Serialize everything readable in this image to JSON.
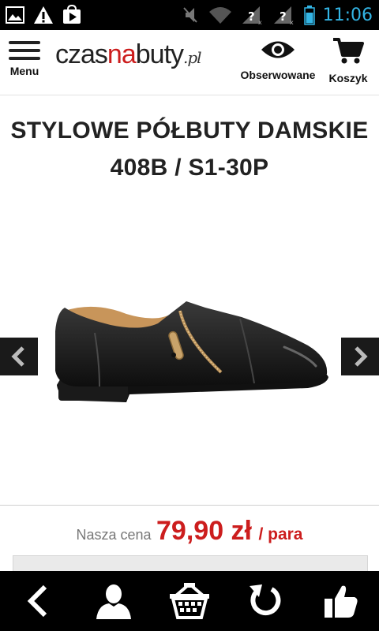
{
  "status_bar": {
    "time": "11:06"
  },
  "header": {
    "menu_label": "Menu",
    "logo": {
      "part1": "czas",
      "part2": "na",
      "part3": "buty",
      "part4": ".pl"
    },
    "observed_label": "Obserwowane",
    "cart_label": "Koszyk"
  },
  "product": {
    "title": "STYLOWE PÓŁBUTY DAMSKIE 408B / S1-30P",
    "price_label": "Nasza cena",
    "price": "79,90 zł",
    "price_unit": "/ para"
  },
  "colors": {
    "accent": "#cc1d1d",
    "status_time": "#33b5e5"
  },
  "icons": {
    "status_left": [
      "image-icon",
      "warning-icon",
      "play-store-icon"
    ],
    "status_right": [
      "muted-icon",
      "wifi-icon",
      "signal-unknown-icon",
      "signal-unknown-icon",
      "battery-icon"
    ],
    "header": [
      "menu-icon",
      "eye-icon",
      "cart-icon"
    ],
    "gallery": [
      "arrow-left-icon",
      "arrow-right-icon"
    ],
    "bottom_nav": [
      "back-icon",
      "user-icon",
      "basket-icon",
      "refresh-icon",
      "thumbs-up-icon"
    ]
  }
}
